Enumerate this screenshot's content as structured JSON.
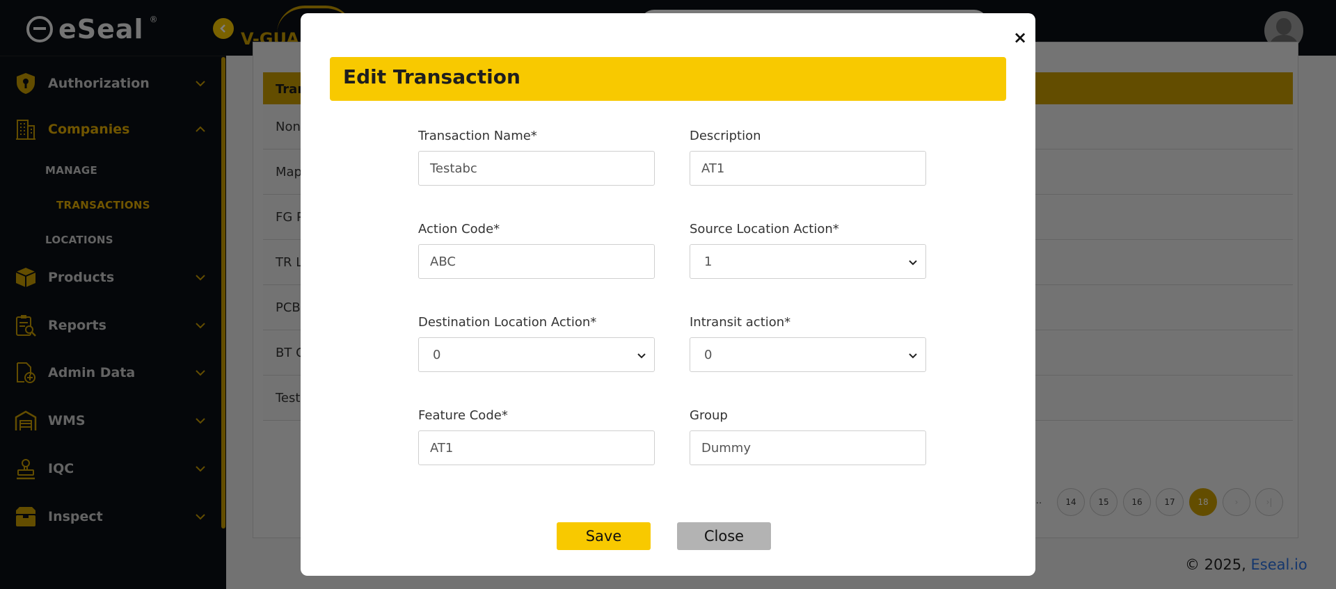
{
  "brand": {
    "name": "eSeal",
    "reg": "®"
  },
  "header": {
    "collapse_icon": "chevron-left-icon",
    "partner_logo": "V-GUAR"
  },
  "sidebar": {
    "items": [
      {
        "label": "Authorization",
        "icon": "shield-key-icon"
      },
      {
        "label": "Companies",
        "icon": "building-icon"
      },
      {
        "label": "Products",
        "icon": "box-icon"
      },
      {
        "label": "Reports",
        "icon": "report-search-icon"
      },
      {
        "label": "Admin Data",
        "icon": "document-add-icon"
      },
      {
        "label": "WMS",
        "icon": "warehouse-icon"
      },
      {
        "label": "IQC",
        "icon": "stamp-icon"
      },
      {
        "label": "Inspect",
        "icon": "package-icon"
      }
    ],
    "subitems": [
      "MANAGE",
      "TRANSACTIONS",
      "LOCATIONS"
    ]
  },
  "table": {
    "header": "Tran",
    "rows": [
      "Non",
      "Map",
      "FG P",
      "TR Lo",
      "PCB",
      "BT C",
      "Test"
    ]
  },
  "pagination": {
    "pages": [
      "14",
      "15",
      "16",
      "17",
      "18"
    ],
    "active": "18",
    "next": "›",
    "last": "›|",
    "ellipsis": "..."
  },
  "footer": {
    "copyright": "© 2025, ",
    "link": "Eseal.io"
  },
  "modal": {
    "title": "Edit Transaction",
    "close": "×",
    "fields": {
      "transaction_name": {
        "label": "Transaction Name*",
        "value": "Testabc"
      },
      "description": {
        "label": "Description",
        "value": "AT1"
      },
      "action_code": {
        "label": "Action Code*",
        "value": "ABC"
      },
      "source_location_action": {
        "label": "Source Location Action*",
        "value": "1"
      },
      "destination_location_action": {
        "label": "Destination Location Action*",
        "value": "0"
      },
      "intransit_action": {
        "label": "Intransit action*",
        "value": "0"
      },
      "feature_code": {
        "label": "Feature Code*",
        "value": "AT1"
      },
      "group": {
        "label": "Group",
        "value": "Dummy"
      }
    },
    "save_label": "Save",
    "close_label": "Close"
  },
  "colors": {
    "accent": "#f8c900",
    "sidebar_bg": "#0b0f14",
    "active_nav": "#e0ab00"
  }
}
